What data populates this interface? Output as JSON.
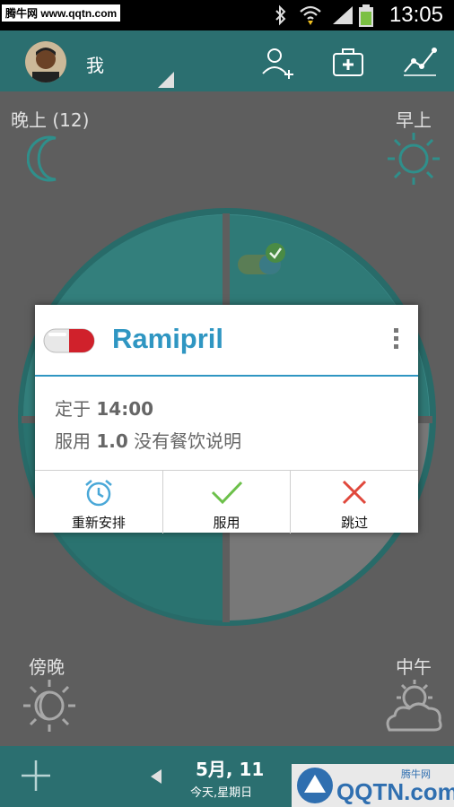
{
  "status_bar": {
    "watermark": "腾牛网 www.qqtn.com",
    "time": "13:05"
  },
  "header": {
    "user_name": "我",
    "icons": [
      "add-user-icon",
      "medicine-box-icon",
      "chart-icon"
    ]
  },
  "periods": {
    "night": {
      "label": "晚上 (12)",
      "icon": "moon-icon"
    },
    "morning": {
      "label": "早上",
      "icon": "sun-icon"
    },
    "evening": {
      "label": "傍晚",
      "icon": "sunset-icon"
    },
    "noon": {
      "label": "中午",
      "icon": "cloud-sun-icon"
    }
  },
  "dialog": {
    "medication": "Ramipril",
    "line1_prefix": "定于 ",
    "line1_time": "14:00",
    "line2_prefix": "服用 ",
    "line2_dose": "1.0",
    "line2_suffix": " 没有餐饮说明",
    "actions": [
      {
        "label": "重新安排",
        "icon": "alarm-clock-icon",
        "color": "#4aa8d8"
      },
      {
        "label": "服用",
        "icon": "check-icon",
        "color": "#6cc04a"
      },
      {
        "label": "跳过",
        "icon": "close-icon",
        "color": "#e0483c"
      }
    ]
  },
  "bottom_bar": {
    "date": "5月, 11",
    "sub": "今天,星期日"
  },
  "corner_watermark": {
    "brand": "腾牛网",
    "site": "QQTN.com"
  },
  "colors": {
    "primary": "#2b6f70",
    "accent": "#2f96c2"
  }
}
